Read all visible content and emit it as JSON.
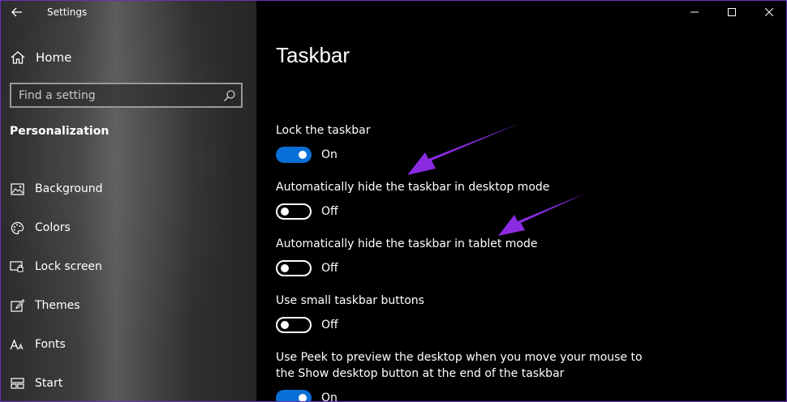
{
  "window": {
    "app_title": "Settings"
  },
  "sidebar": {
    "home_label": "Home",
    "search_placeholder": "Find a setting",
    "section": "Personalization",
    "items": [
      {
        "label": "Background",
        "icon": "image-icon"
      },
      {
        "label": "Colors",
        "icon": "palette-icon"
      },
      {
        "label": "Lock screen",
        "icon": "lock-screen-icon"
      },
      {
        "label": "Themes",
        "icon": "brush-icon"
      },
      {
        "label": "Fonts",
        "icon": "font-icon"
      },
      {
        "label": "Start",
        "icon": "start-icon"
      }
    ]
  },
  "main": {
    "title": "Taskbar",
    "settings": [
      {
        "label": "Lock the taskbar",
        "state": "On",
        "on": true
      },
      {
        "label": "Automatically hide the taskbar in desktop mode",
        "state": "Off",
        "on": false
      },
      {
        "label": "Automatically hide the taskbar in tablet mode",
        "state": "Off",
        "on": false
      },
      {
        "label": "Use small taskbar buttons",
        "state": "Off",
        "on": false
      },
      {
        "label_line1": "Use Peek to preview the desktop when you move your mouse to",
        "label_line2": "the Show desktop button at the end of the taskbar",
        "state": "On",
        "on": true
      }
    ]
  },
  "colors": {
    "accent": "#0a6fd6",
    "annotation_arrow": "#8a2be2"
  }
}
